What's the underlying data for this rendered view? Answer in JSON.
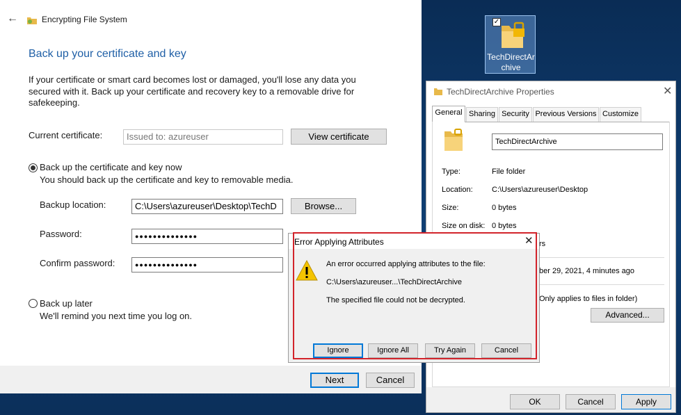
{
  "efs": {
    "window_title": "Encrypting File System",
    "heading": "Back up your certificate and key",
    "intro": "If your certificate or smart card becomes lost or damaged, you'll lose any data you secured with it. Back up your certificate and recovery key to a removable drive for safekeeping.",
    "current_cert_label": "Current certificate:",
    "current_cert_value": "Issued to: azureuser",
    "view_cert_button": "View certificate",
    "option_now_label": "Back up the certificate and key now",
    "option_now_desc": "You should back up the certificate and key to removable media.",
    "backup_location_label": "Backup location:",
    "backup_location_value": "C:\\Users\\azureuser\\Desktop\\TechD",
    "browse_button": "Browse...",
    "password_label": "Password:",
    "password_value": "●●●●●●●●●●●●●●",
    "confirm_label": "Confirm password:",
    "confirm_value": "●●●●●●●●●●●●●●",
    "option_later_label": "Back up later",
    "option_later_desc": "We'll remind you next time you log on.",
    "next_button": "Next",
    "cancel_button": "Cancel"
  },
  "desktop_icon": {
    "label_line1": "TechDirectAr",
    "label_line2": "chive"
  },
  "props": {
    "title": "TechDirectArchive Properties",
    "tabs": [
      "General",
      "Sharing",
      "Security",
      "Previous Versions",
      "Customize"
    ],
    "name_value": "TechDirectArchive",
    "type_label": "Type:",
    "type_value": "File folder",
    "location_label": "Location:",
    "location_value": "C:\\Users\\azureuser\\Desktop",
    "size_label": "Size:",
    "size_value": "0 bytes",
    "size_on_disk_label": "Size on disk:",
    "size_on_disk_value": "0 bytes",
    "contains_partial": "rs",
    "created_partial": "ber 29, 2021, 4 minutes ago",
    "readonly_partial": "Only applies to files in folder)",
    "advanced_button": "Advanced...",
    "ok_button": "OK",
    "cancel_button": "Cancel",
    "apply_button": "Apply"
  },
  "error_dialog": {
    "title": "Error Applying Attributes",
    "line1": "An error occurred applying attributes to the file:",
    "line2": "C:\\Users\\azureuser...\\TechDirectArchive",
    "line3": "The specified file could not be decrypted.",
    "buttons": [
      "Ignore",
      "Ignore All",
      "Try Again",
      "Cancel"
    ]
  },
  "colors": {
    "heading_blue": "#1f5fa6",
    "highlight_red": "#d2232a",
    "focus_blue": "#0078d7"
  }
}
